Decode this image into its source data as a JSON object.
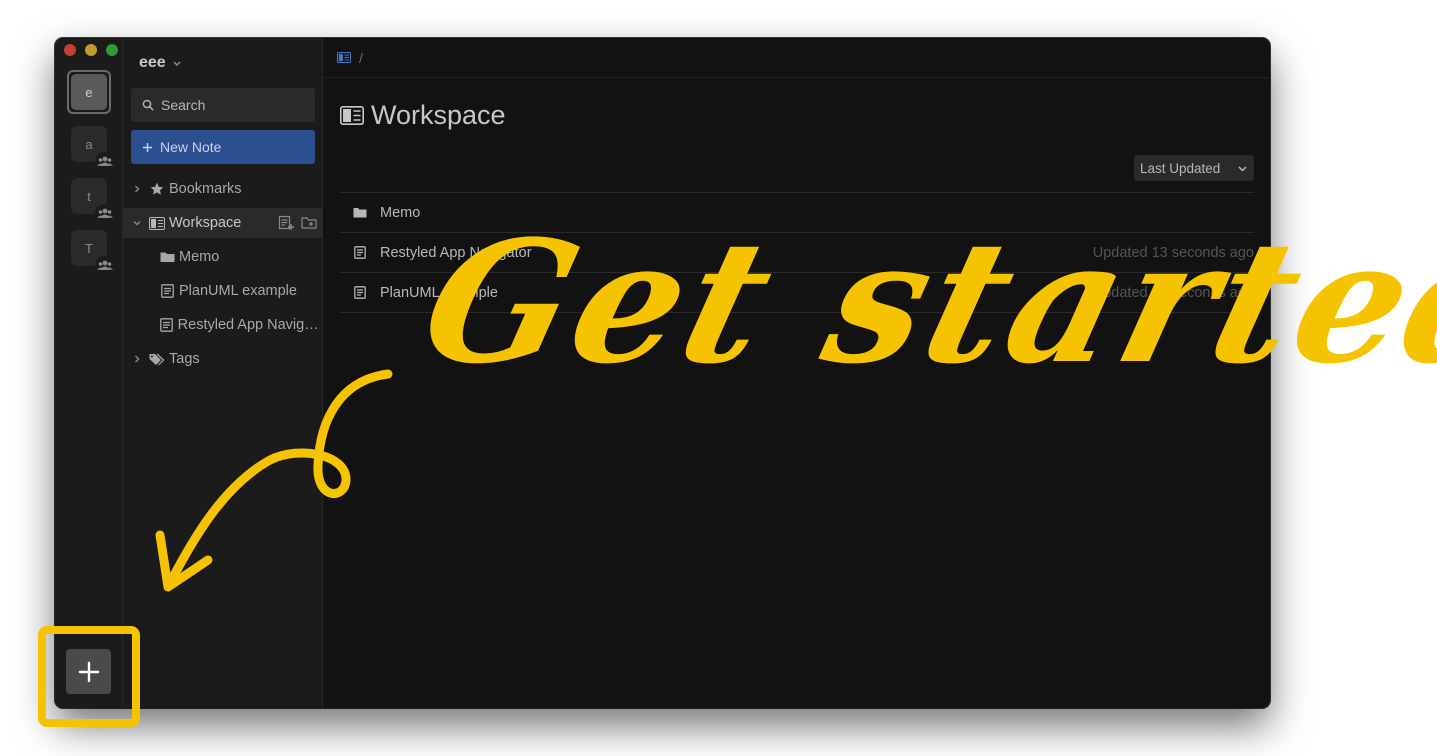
{
  "workspace": {
    "name": "eee"
  },
  "rail": {
    "items": [
      {
        "letter": "e",
        "active": true,
        "shared": false
      },
      {
        "letter": "a",
        "active": false,
        "shared": true
      },
      {
        "letter": "t",
        "active": false,
        "shared": true
      },
      {
        "letter": "T",
        "active": false,
        "shared": true
      }
    ],
    "add_label": "+"
  },
  "sidebar": {
    "search_label": "Search",
    "new_note_label": "New Note",
    "bookmarks_label": "Bookmarks",
    "workspace_label": "Workspace",
    "children": [
      {
        "label": "Memo",
        "icon": "folder-icon"
      },
      {
        "label": "PlanUML example",
        "icon": "note-icon"
      },
      {
        "label": "Restyled App Navigator",
        "icon": "note-icon"
      }
    ],
    "tags_label": "Tags"
  },
  "topbar": {
    "separator": "/"
  },
  "main": {
    "title": "Workspace",
    "sort_label": "Last Updated",
    "rows": [
      {
        "icon": "folder-icon",
        "name": "Memo",
        "time": ""
      },
      {
        "icon": "note-icon",
        "name": "Restyled App Navigator",
        "time": "Updated 13 seconds ago"
      },
      {
        "icon": "note-icon",
        "name": "PlanUML example",
        "time": "Updated 13 seconds ago"
      }
    ]
  },
  "overlay": {
    "headline": "Get started"
  },
  "colors": {
    "accent": "#f5c300",
    "primary_button": "#2b4f8f",
    "background": "#121212"
  }
}
